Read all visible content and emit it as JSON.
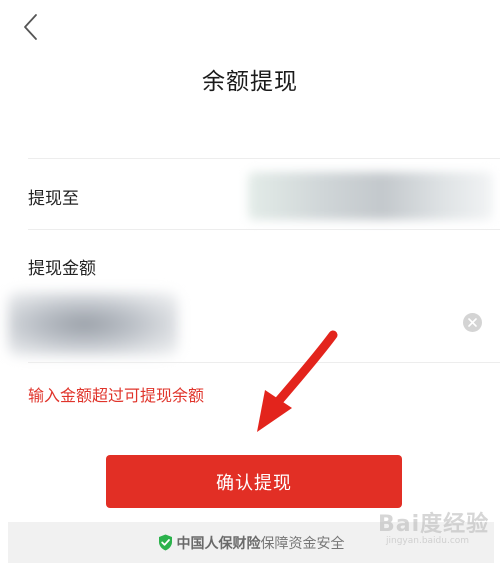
{
  "header": {
    "title": "余额提现"
  },
  "form": {
    "to_label": "提现至",
    "amount_label": "提现金额",
    "amount_value": "",
    "error_message": "输入金额超过可提现余额"
  },
  "actions": {
    "confirm_label": "确认提现"
  },
  "footer": {
    "brand": "中国人保财险",
    "text": "保障资金安全"
  },
  "watermark": {
    "main": "Bai度经验",
    "sub": "jingyan.baidu.com"
  },
  "colors": {
    "accent": "#e22f25",
    "error": "#e0342b",
    "shield": "#2bb24c"
  },
  "icons": {
    "back": "chevron-left-icon",
    "clear": "clear-circle-icon",
    "shield": "shield-check-icon"
  }
}
